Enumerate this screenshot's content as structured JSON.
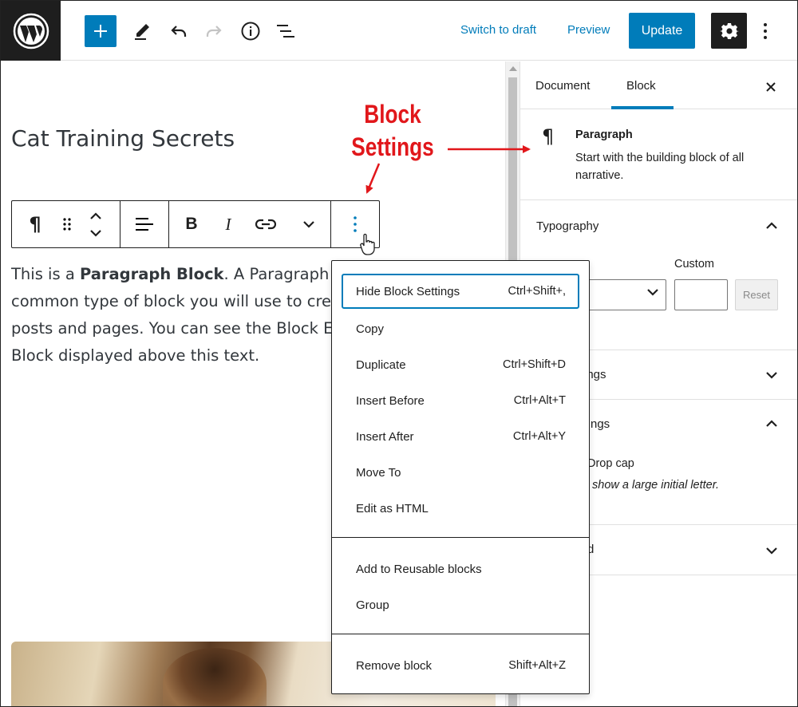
{
  "topbar": {
    "switch_to_draft": "Switch to draft",
    "preview": "Preview",
    "update": "Update",
    "accent_color": "#007cba"
  },
  "editor": {
    "post_title": "Cat Training Secrets",
    "paragraph": {
      "line1_pre": "This is a ",
      "line1_bold": "Paragraph Block",
      "line1_post": ". A Paragraph Blo",
      "line2": "common type of block you will use to create",
      "line3": "posts and pages. You can see the Block Edit",
      "line4": "Block displayed above this text."
    }
  },
  "block_toolbar": {
    "icons": [
      "paragraph-icon",
      "drag-handle-icon",
      "move-up-down-icon",
      "align-left-icon",
      "bold-icon",
      "italic-icon",
      "link-icon",
      "chevron-down-icon",
      "more-options-icon"
    ]
  },
  "menu": {
    "items": [
      {
        "label": "Hide Block Settings",
        "shortcut": "Ctrl+Shift+,"
      },
      {
        "label": "Copy",
        "shortcut": ""
      },
      {
        "label": "Duplicate",
        "shortcut": "Ctrl+Shift+D"
      },
      {
        "label": "Insert Before",
        "shortcut": "Ctrl+Alt+T"
      },
      {
        "label": "Insert After",
        "shortcut": "Ctrl+Alt+Y"
      },
      {
        "label": "Move To",
        "shortcut": ""
      },
      {
        "label": "Edit as HTML",
        "shortcut": ""
      },
      {
        "label": "Add to Reusable blocks",
        "shortcut": ""
      },
      {
        "label": "Group",
        "shortcut": ""
      },
      {
        "label": "Remove block",
        "shortcut": "Shift+Alt+Z"
      }
    ]
  },
  "sidebar": {
    "tabs": [
      "Document",
      "Block"
    ],
    "active_tab": "Block",
    "block_card": {
      "icon": "¶",
      "title": "Paragraph",
      "description": "Start with the building block of all narrative."
    },
    "typography": {
      "title": "Typography",
      "font_size_label_partial": "e",
      "custom_label": "Custom",
      "reset": "Reset"
    },
    "color_settings_partial": "ings",
    "text_settings_partial": "ngs",
    "drop_cap_partial": "Drop cap",
    "drop_cap_help_partial": "show a large initial letter.",
    "advanced_partial": "d"
  },
  "annotation": {
    "line1": "Block",
    "line2": "Settings",
    "color": "#e1171b"
  }
}
